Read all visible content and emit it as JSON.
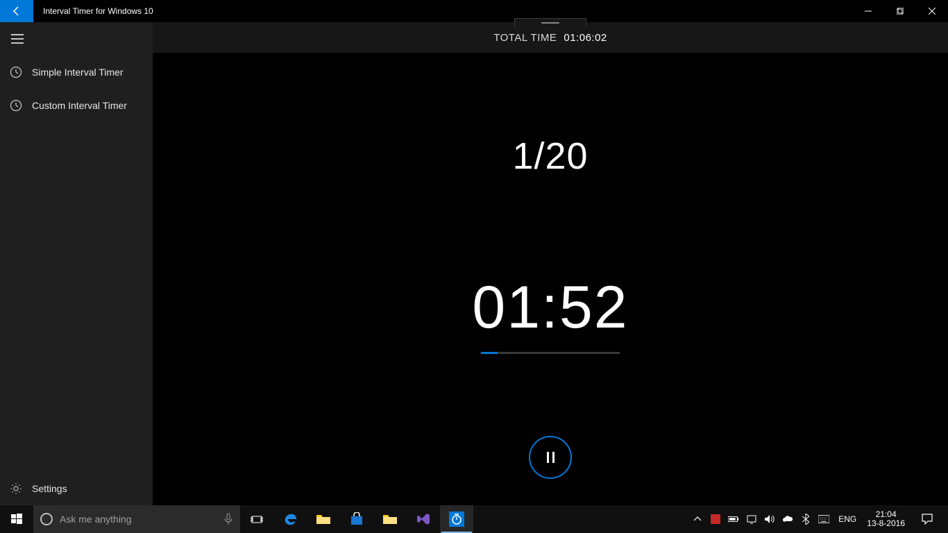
{
  "titlebar": {
    "app_title": "Interval Timer for Windows 10"
  },
  "sidebar": {
    "items": [
      {
        "label": "Simple Interval Timer"
      },
      {
        "label": "Custom Interval Timer"
      }
    ],
    "settings_label": "Settings"
  },
  "header": {
    "total_time_label": "TOTAL TIME",
    "total_time_value": "01:06:02"
  },
  "timer": {
    "interval_progress": "1/20",
    "current_time": "01:52",
    "progress_percent": 12
  },
  "taskbar": {
    "search_placeholder": "Ask me anything",
    "lang": "ENG",
    "time": "21:04",
    "date": "13-8-2016"
  },
  "colors": {
    "accent": "#0078d7"
  }
}
